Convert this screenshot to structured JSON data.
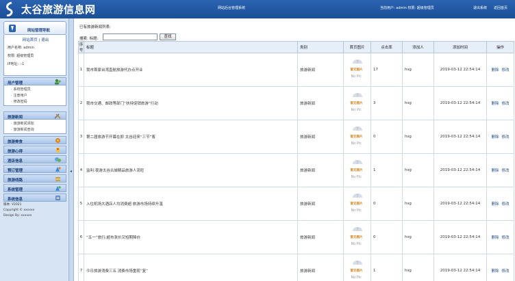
{
  "header": {
    "site_title": "太谷旅游信息网",
    "system_title": "网站后台管理系统",
    "user_info": "当前用户: admin  权限: 超级管理员",
    "exit_label": "退出系统",
    "home_label": "返回首页"
  },
  "sidebar": {
    "nav_title": "网站管理导航",
    "home_link": "网站首页",
    "logout_link": "退出",
    "username_line": "用户名称: admin",
    "role_line": "权限: 超级管理员",
    "ip_line": "IP地址: ::1",
    "groups": [
      {
        "label": "用户管理",
        "items": [
          "系统管理员",
          "注册用户",
          "修改密码"
        ]
      },
      {
        "label": "旅游新闻",
        "items": [
          "旅游新闻添加",
          "旅游新闻查询"
        ]
      },
      {
        "label": "旅游美食"
      },
      {
        "label": "旅游心得"
      },
      {
        "label": "酒店信息"
      },
      {
        "label": "预订管理"
      },
      {
        "label": "旅游线路"
      },
      {
        "label": "系统管理"
      },
      {
        "label": "系统信息"
      }
    ],
    "footer_lines": [
      "版本: V2021",
      "Copyright © xxxxxx",
      "Design By: xxxxxx"
    ]
  },
  "main": {
    "breadcrumb": "已有旅游新闻列表:",
    "search_label": "搜索: 标题:",
    "search_value": "",
    "search_button": "查找",
    "columns": [
      "序号",
      "标题",
      "类别",
      "首页图片",
      "点击率",
      "添加人",
      "添加时间",
      "操作"
    ],
    "nopic_label": "暂无图片",
    "nopic_text": "No Pic",
    "delete_label": "删除",
    "edit_label": "修改",
    "rows": [
      {
        "no": "1",
        "title": "我市首家台湾直航旅游代办点开业",
        "category": "旅游新闻",
        "clicks": "17",
        "author": "hsg",
        "time": "2019-03-12 22:54:14"
      },
      {
        "no": "2",
        "title": "我市交通、邮政等部门“扶持促销旅游”行动",
        "category": "旅游新闻",
        "clicks": "3",
        "author": "hsg",
        "time": "2019-03-12 22:54:14"
      },
      {
        "no": "3",
        "title": "第二届旅游节开幕在即 太谷迎来“三节”客",
        "category": "旅游新闻",
        "clicks": "0",
        "author": "hsg",
        "time": "2019-03-12 22:54:14"
      },
      {
        "no": "4",
        "title": "监利:夜游太谷古城精品旅游人流旺",
        "category": "旅游新闻",
        "clicks": "1",
        "author": "hsg",
        "time": "2019-03-12 22:54:14"
      },
      {
        "no": "5",
        "title": "入住机场大酒店人均消费超 旅游市场持续升温",
        "category": "旅游新闻",
        "clicks": "0",
        "author": "hsg",
        "time": "2019-03-12 22:54:14"
      },
      {
        "no": "6",
        "title": "“五一”旅行:超市涨价又短期降价",
        "category": "旅游新闻",
        "clicks": "0",
        "author": "hsg",
        "time": "2019-03-12 22:54:14"
      },
      {
        "no": "7",
        "title": "今日旅游消费三五 消费市场重现“复”",
        "category": "旅游新闻",
        "clicks": "1",
        "author": "hsg",
        "time": "2019-03-12 22:54:14"
      }
    ]
  },
  "colors": {
    "header_bg": "#1c4f98",
    "sidebar_bg": "#d7e4f3",
    "link": "#1f4a8a",
    "nopic_text": "#d08a2a"
  },
  "icons": [
    "logo-icon",
    "nav-head-icon",
    "users-icon",
    "tools-icon",
    "food-icon",
    "notes-icon",
    "hotel-icon",
    "order-icon",
    "route-icon",
    "system-icon",
    "info-icon",
    "collapse-arrow-icon",
    "no-image-icon"
  ]
}
